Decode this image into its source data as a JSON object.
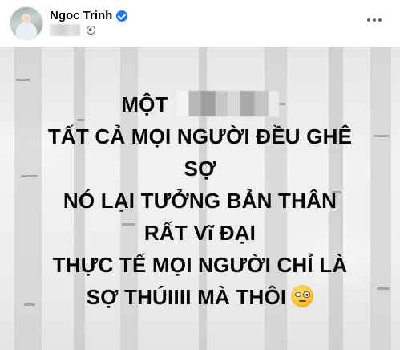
{
  "post": {
    "author_name": "Ngoc Trinh",
    "verified": true,
    "privacy_icon": "globe-icon",
    "menu_icon": "more-icon",
    "text_lines": [
      "MỘT",
      "TẤT CẢ MỌI NGƯỜI ĐỀU GHÊ",
      "SỢ",
      "NÓ LẠI TƯỞNG BẢN THÂN",
      "RẤT Vĩ ĐẠI",
      "THỰC TẾ MỌI NGƯỜI CHỈ LÀ",
      "SỢ THÚIIII MÀ THÔI"
    ],
    "emoji": "face-with-uneven-eyes",
    "accent_color": "#1877f2"
  }
}
